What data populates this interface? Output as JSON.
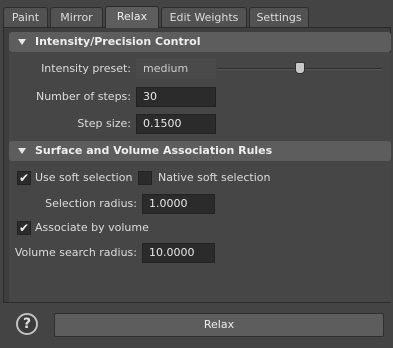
{
  "tabs": [
    {
      "label": "Paint"
    },
    {
      "label": "Mirror"
    },
    {
      "label": "Relax"
    },
    {
      "label": "Edit Weights"
    },
    {
      "label": "Settings"
    }
  ],
  "active_tab": "Relax",
  "intensity_section": {
    "title": "Intensity/Precision Control",
    "preset_label": "Intensity preset:",
    "preset_value": "medium",
    "preset_slider_fraction": 0.5,
    "steps_label": "Number of steps:",
    "steps_value": "30",
    "stepsize_label": "Step size:",
    "stepsize_value": "0.1500"
  },
  "association_section": {
    "title": "Surface and Volume Association Rules",
    "soft_selection_label": "Use soft selection",
    "soft_selection_checked": true,
    "native_soft_label": "Native soft selection",
    "native_soft_checked": false,
    "selection_radius_label": "Selection radius:",
    "selection_radius_value": "1.0000",
    "associate_volume_label": "Associate by volume",
    "associate_volume_checked": true,
    "volume_radius_label": "Volume search radius:",
    "volume_radius_value": "10.0000"
  },
  "footer": {
    "help_glyph": "?",
    "relax_button_label": "Relax"
  },
  "icons": {
    "collapse": "triangle-down-icon",
    "check": "checkmark-icon",
    "help": "question-mark-icon"
  }
}
